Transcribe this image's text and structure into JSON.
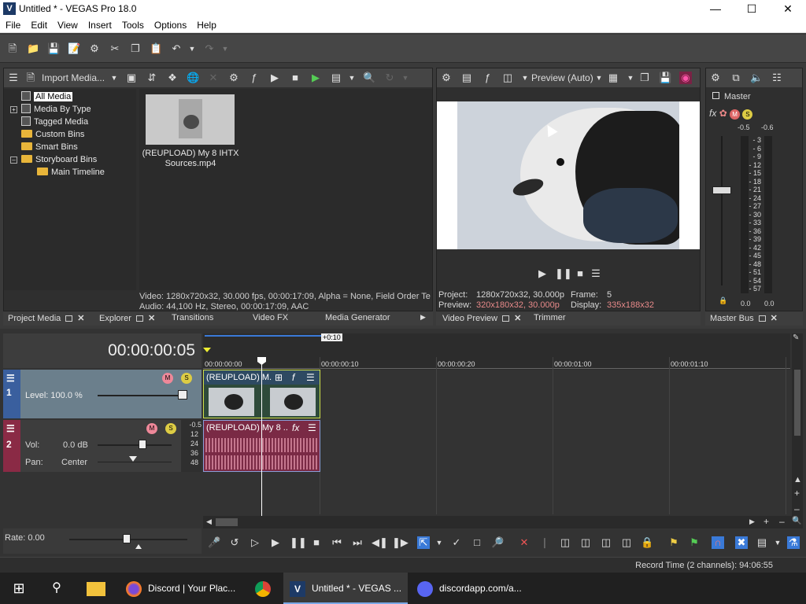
{
  "window": {
    "title": "Untitled * - VEGAS Pro 18.0",
    "app_icon": "V"
  },
  "menu": [
    "File",
    "Edit",
    "View",
    "Insert",
    "Tools",
    "Options",
    "Help"
  ],
  "project_media": {
    "import_label": "Import Media...",
    "tree": [
      "All Media",
      "Media By Type",
      "Tagged Media",
      "Custom Bins",
      "Smart Bins",
      "Storyboard Bins",
      "Main Timeline"
    ],
    "media_item": "(REUPLOAD) My 8 IHTX Sources.mp4",
    "media_item_line1": "(REUPLOAD) My 8 IHTX",
    "media_item_line2": "Sources.mp4",
    "info_video": "Video: 1280x720x32, 30.000 fps, 00:00:17:09, Alpha = None, Field Order Te",
    "info_audio": "Audio: 44,100 Hz, Stereo, 00:00:17:09, AAC"
  },
  "tabs_left": [
    "Project Media",
    "Explorer",
    "Transitions",
    "Video FX",
    "Media Generator"
  ],
  "preview": {
    "mode": "Preview (Auto)",
    "project_label": "Project:",
    "project_value": "1280x720x32, 30.000p",
    "preview_label": "Preview:",
    "preview_value": "320x180x32, 30.000p",
    "frame_label": "Frame:",
    "frame_value": "5",
    "display_label": "Display:",
    "display_value": "335x188x32"
  },
  "tabs_preview": [
    "Video Preview",
    "Trimmer"
  ],
  "master": {
    "label": "Master",
    "peak_left": "-0.5",
    "peak_right": "-0.6",
    "scale": [
      "3",
      "6",
      "9",
      "12",
      "15",
      "18",
      "21",
      "24",
      "27",
      "30",
      "33",
      "36",
      "39",
      "42",
      "45",
      "48",
      "51",
      "54",
      "57"
    ],
    "bottom_left": "0.0",
    "bottom_right": "0.0",
    "tab": "Master Bus"
  },
  "timeline": {
    "timecode": "00:00:00:05",
    "region_label": "+0:10",
    "ruler": [
      "00:00:00:00",
      "00:00:00:10",
      "00:00:00:20",
      "00:00:01:00",
      "00:00:01:10"
    ],
    "video_track": {
      "num": "1",
      "level_label": "Level: 100.0 %",
      "clip_title": "(REUPLOAD) M..."
    },
    "audio_track": {
      "num": "2",
      "vol_label": "Vol:",
      "vol_value": "0.0 dB",
      "pan_label": "Pan:",
      "pan_value": "Center",
      "clip_title": "(REUPLOAD) My 8 ...",
      "db_scale": [
        "-0.5",
        "12",
        "24",
        "36",
        "48"
      ]
    },
    "rate_label": "Rate: 0.00"
  },
  "status": {
    "record_time": "Record Time (2 channels): 94:06:55"
  },
  "taskbar": {
    "discord_label": "Discord | Your Plac...",
    "vegas_label": "Untitled * - VEGAS ...",
    "discordapp_label": "discordapp.com/a..."
  },
  "colors": {
    "accent": "#3a5f9e",
    "video_clip_border": "#cfe04b",
    "audio_clip": "#7a2a45",
    "preview_res_highlight": "#e88a8a"
  }
}
